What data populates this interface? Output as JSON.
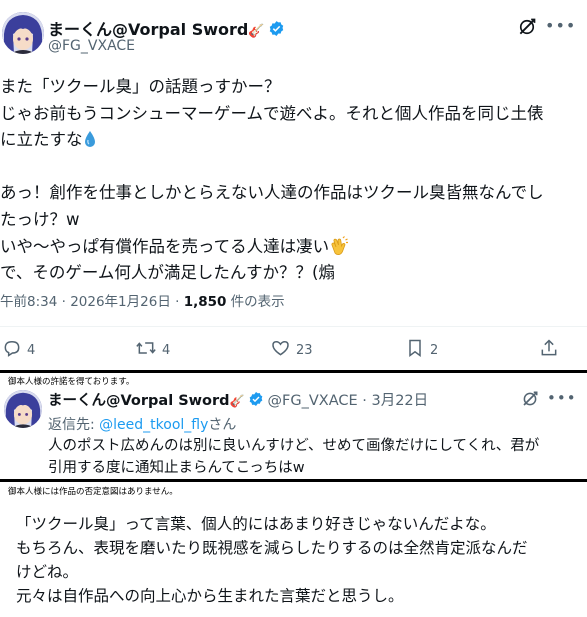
{
  "main_tweet": {
    "display_name": "まーくん@Vorpal Sword",
    "name_emoji": "🎸",
    "handle": "@FG_VXACE",
    "body_lines": [
      "また「ツクール臭」の話題っすかー？",
      "じゃお前もうコンシューマーゲームで遊べよ。それと個人作品を同じ土俵",
      "に立たすな",
      "",
      "あっ！創作を仕事としかとらえない人達の作品はツクール臭皆無なんでし",
      "たっけ？w",
      "いや〜やっぱ有償作品を売ってる人達は凄い",
      "で、そのゲーム何人が満足したんすか？？(煽"
    ],
    "timestamp": "午前8:34 · 2026年1月26日 · ",
    "views_count": "1,850",
    "views_label": " 件の表示",
    "actions": {
      "reply_count": "4",
      "retweet_count": "4",
      "like_count": "23",
      "bookmark_count": "2"
    }
  },
  "reply_tweet": {
    "note": "御本人様の許諾を得ております。",
    "display_name": "まーくん@Vorpal Sword",
    "name_emoji": "🎸",
    "handle_date": "@FG_VXACE · 3月22日",
    "reply_prefix": "返信先: ",
    "reply_to": "@leed_tkool_fly",
    "reply_suffix": "さん",
    "body_lines": [
      "人のポスト広めんのは別に良いんすけど、せめて画像だけにしてくれ、君が",
      "引用する度に通知止まらんてこっちはw"
    ]
  },
  "quote_panel": {
    "note": "御本人様には作品の否定意図はありません。",
    "body_lines": [
      "「ツクール臭」って言葉、個人的にはあまり好きじゃないんだよな。",
      "もちろん、表現を磨いたり既視感を減らしたりするのは全然肯定派なんだ",
      "けどね。",
      "元々は自作品への向上心から生まれた言葉だと思うし。"
    ]
  },
  "colors": {
    "accent": "#1d9bf0",
    "secondary_text": "#536471",
    "divider": "#eff3f4"
  },
  "icons": {
    "verified": "verified-badge-icon",
    "grok": "grok-icon",
    "more": "more-icon",
    "reply": "reply-icon",
    "retweet": "retweet-icon",
    "like": "like-icon",
    "bookmark": "bookmark-icon",
    "share": "share-icon",
    "droplet": "droplet-emoji",
    "clap": "clap-emoji"
  }
}
